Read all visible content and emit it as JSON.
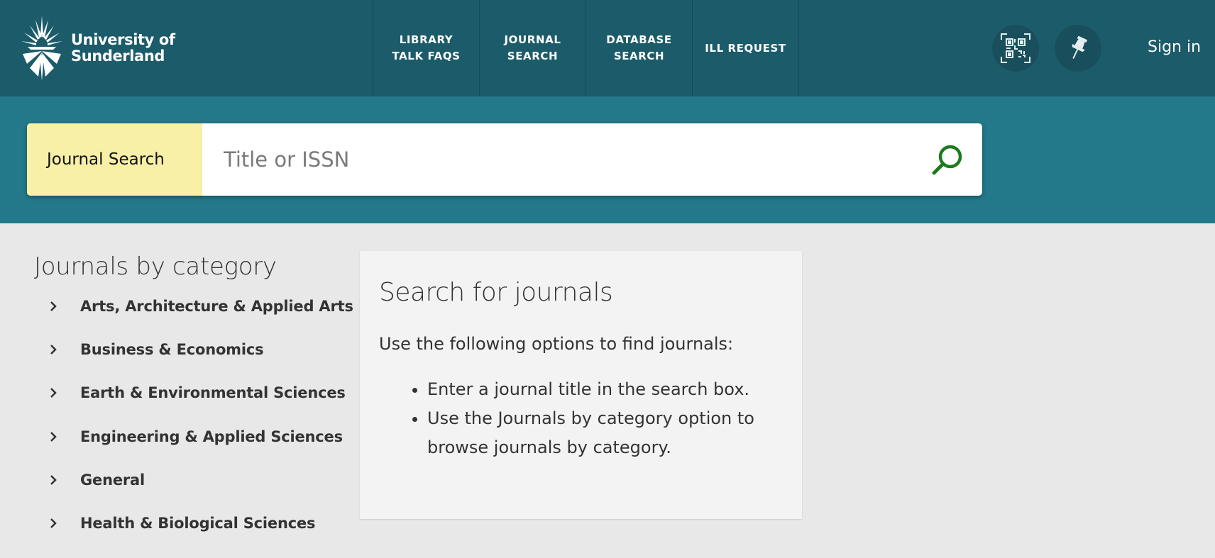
{
  "header": {
    "logo_line1": "University of",
    "logo_line2": "Sunderland",
    "nav": [
      {
        "label": "LIBRARY\nTALK FAQS"
      },
      {
        "label": "JOURNAL\nSEARCH"
      },
      {
        "label": "DATABASE\nSEARCH"
      },
      {
        "label": "ILL REQUEST"
      }
    ],
    "signin": "Sign in",
    "icons": [
      "qr-code-icon",
      "pin-icon"
    ]
  },
  "search": {
    "label": "Journal Search",
    "placeholder": "Title or ISSN",
    "value": ""
  },
  "categories": {
    "title": "Journals by category",
    "items": [
      {
        "label": "Arts, Architecture & Applied Arts"
      },
      {
        "label": "Business & Economics"
      },
      {
        "label": "Earth & Environmental Sciences"
      },
      {
        "label": "Engineering & Applied Sciences"
      },
      {
        "label": "General"
      },
      {
        "label": "Health & Biological Sciences"
      }
    ]
  },
  "info": {
    "title": "Search for journals",
    "intro": "Use the following options to find journals:",
    "bullets": [
      "Enter a journal title in the search box.",
      "Use the Journals by category option to browse journals by category."
    ]
  },
  "colors": {
    "header_bg": "#1c5b6a",
    "search_band_bg": "#237889",
    "search_label_bg": "#f8f0a6",
    "search_icon": "#1e7a1e",
    "page_bg": "#e8e8e8"
  }
}
